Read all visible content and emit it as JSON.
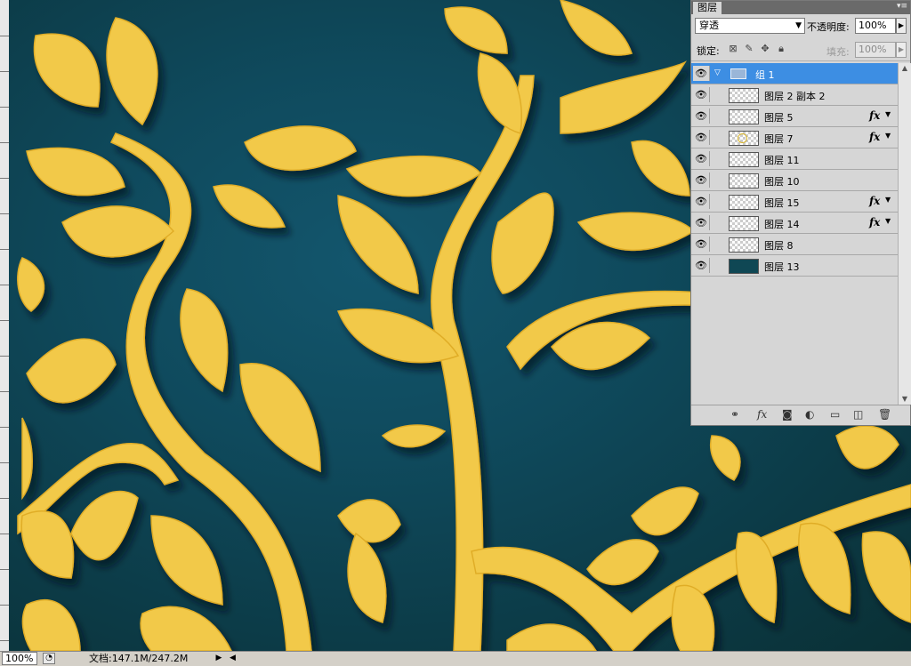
{
  "panel": {
    "title": "图层",
    "blend_mode": "穿透",
    "opacity_label": "不透明度:",
    "opacity_value": "100%",
    "lock_label": "锁定:",
    "fill_label": "填充:",
    "fill_value": "100%"
  },
  "layers": [
    {
      "name": "组 1",
      "type": "group",
      "fx": ""
    },
    {
      "name": "图层 2 副本 2",
      "type": "layer",
      "fx": ""
    },
    {
      "name": "图层 5",
      "type": "layer",
      "fx": "fx"
    },
    {
      "name": "图层 7",
      "type": "layer",
      "fx": "fx"
    },
    {
      "name": "图层 11",
      "type": "layer",
      "fx": ""
    },
    {
      "name": "图层 10",
      "type": "layer",
      "fx": ""
    },
    {
      "name": "图层 15",
      "type": "layer",
      "fx": "fx"
    },
    {
      "name": "图层 14",
      "type": "layer",
      "fx": "fx"
    },
    {
      "name": "图层 8",
      "type": "layer",
      "fx": ""
    },
    {
      "name": "图层 13",
      "type": "layer",
      "fx": ""
    }
  ],
  "status": {
    "zoom": "100%",
    "doc_info": "文档:147.1M/247.2M"
  },
  "colors": {
    "leaf_gold": "#f2c94a",
    "background_teal": "#0f4a5d",
    "selected_row": "#3d8ee3"
  },
  "icons": {
    "eye": "visibility-eye-icon",
    "fx": "layer-style-fx-icon",
    "folder": "folder-icon"
  }
}
